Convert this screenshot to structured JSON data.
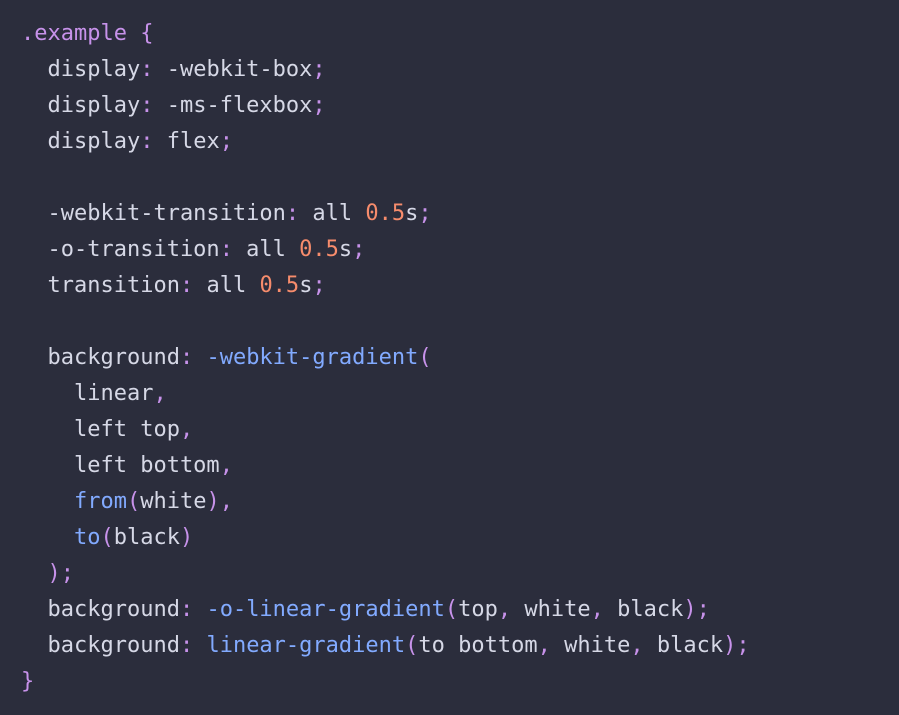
{
  "colors": {
    "background": "#2b2d3c",
    "plain": "#d6d8e6",
    "punctuation": "#c792ea",
    "number": "#f78c6c",
    "function": "#82aaff"
  },
  "code": {
    "lines": [
      [
        {
          "t": ".example ",
          "k": "selector"
        },
        {
          "t": "{",
          "k": "punct"
        }
      ],
      [
        {
          "t": "  display",
          "k": "plain"
        },
        {
          "t": ":",
          "k": "punct"
        },
        {
          "t": " -webkit-box",
          "k": "plain"
        },
        {
          "t": ";",
          "k": "punct"
        }
      ],
      [
        {
          "t": "  display",
          "k": "plain"
        },
        {
          "t": ":",
          "k": "punct"
        },
        {
          "t": " -ms-flexbox",
          "k": "plain"
        },
        {
          "t": ";",
          "k": "punct"
        }
      ],
      [
        {
          "t": "  display",
          "k": "plain"
        },
        {
          "t": ":",
          "k": "punct"
        },
        {
          "t": " flex",
          "k": "plain"
        },
        {
          "t": ";",
          "k": "punct"
        }
      ],
      [],
      [
        {
          "t": "  -webkit-transition",
          "k": "plain"
        },
        {
          "t": ":",
          "k": "punct"
        },
        {
          "t": " all ",
          "k": "plain"
        },
        {
          "t": "0.5",
          "k": "number"
        },
        {
          "t": "s",
          "k": "plain"
        },
        {
          "t": ";",
          "k": "punct"
        }
      ],
      [
        {
          "t": "  -o-transition",
          "k": "plain"
        },
        {
          "t": ":",
          "k": "punct"
        },
        {
          "t": " all ",
          "k": "plain"
        },
        {
          "t": "0.5",
          "k": "number"
        },
        {
          "t": "s",
          "k": "plain"
        },
        {
          "t": ";",
          "k": "punct"
        }
      ],
      [
        {
          "t": "  transition",
          "k": "plain"
        },
        {
          "t": ":",
          "k": "punct"
        },
        {
          "t": " all ",
          "k": "plain"
        },
        {
          "t": "0.5",
          "k": "number"
        },
        {
          "t": "s",
          "k": "plain"
        },
        {
          "t": ";",
          "k": "punct"
        }
      ],
      [],
      [
        {
          "t": "  background",
          "k": "plain"
        },
        {
          "t": ":",
          "k": "punct"
        },
        {
          "t": " ",
          "k": "plain"
        },
        {
          "t": "-webkit-gradient",
          "k": "function"
        },
        {
          "t": "(",
          "k": "punct"
        }
      ],
      [
        {
          "t": "    linear",
          "k": "plain"
        },
        {
          "t": ",",
          "k": "punct"
        }
      ],
      [
        {
          "t": "    left top",
          "k": "plain"
        },
        {
          "t": ",",
          "k": "punct"
        }
      ],
      [
        {
          "t": "    left bottom",
          "k": "plain"
        },
        {
          "t": ",",
          "k": "punct"
        }
      ],
      [
        {
          "t": "    ",
          "k": "plain"
        },
        {
          "t": "from",
          "k": "function"
        },
        {
          "t": "(",
          "k": "punct"
        },
        {
          "t": "white",
          "k": "plain"
        },
        {
          "t": ")",
          "k": "punct"
        },
        {
          "t": ",",
          "k": "punct"
        }
      ],
      [
        {
          "t": "    ",
          "k": "plain"
        },
        {
          "t": "to",
          "k": "function"
        },
        {
          "t": "(",
          "k": "punct"
        },
        {
          "t": "black",
          "k": "plain"
        },
        {
          "t": ")",
          "k": "punct"
        }
      ],
      [
        {
          "t": "  );",
          "k": "punct"
        }
      ],
      [
        {
          "t": "  background",
          "k": "plain"
        },
        {
          "t": ":",
          "k": "punct"
        },
        {
          "t": " ",
          "k": "plain"
        },
        {
          "t": "-o-linear-gradient",
          "k": "function"
        },
        {
          "t": "(",
          "k": "punct"
        },
        {
          "t": "top",
          "k": "plain"
        },
        {
          "t": ",",
          "k": "punct"
        },
        {
          "t": " white",
          "k": "plain"
        },
        {
          "t": ",",
          "k": "punct"
        },
        {
          "t": " black",
          "k": "plain"
        },
        {
          "t": ");",
          "k": "punct"
        }
      ],
      [
        {
          "t": "  background",
          "k": "plain"
        },
        {
          "t": ":",
          "k": "punct"
        },
        {
          "t": " ",
          "k": "plain"
        },
        {
          "t": "linear-gradient",
          "k": "function"
        },
        {
          "t": "(",
          "k": "punct"
        },
        {
          "t": "to bottom",
          "k": "plain"
        },
        {
          "t": ",",
          "k": "punct"
        },
        {
          "t": " white",
          "k": "plain"
        },
        {
          "t": ",",
          "k": "punct"
        },
        {
          "t": " black",
          "k": "plain"
        },
        {
          "t": ");",
          "k": "punct"
        }
      ],
      [
        {
          "t": "}",
          "k": "punct"
        }
      ]
    ]
  }
}
